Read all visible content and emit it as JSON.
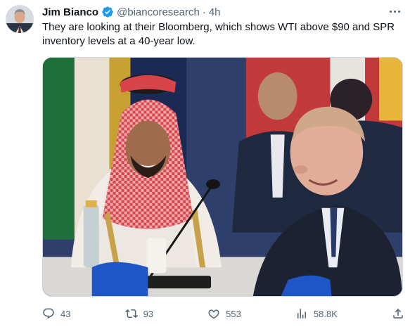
{
  "author": {
    "name": "Jim Bianco",
    "handle": "@biancoresearch",
    "separator": "·",
    "time": "4h"
  },
  "tweet": {
    "text": "They are looking at their Bloomberg, which shows WTI above $90 and SPR inventory levels at a 40-year low."
  },
  "media": {
    "type": "photo"
  },
  "actions": {
    "replies": "43",
    "retweets": "93",
    "likes": "553",
    "views": "58.8K"
  },
  "colors": {
    "verified": "#1d9bf0",
    "secondary_text": "#536471"
  }
}
